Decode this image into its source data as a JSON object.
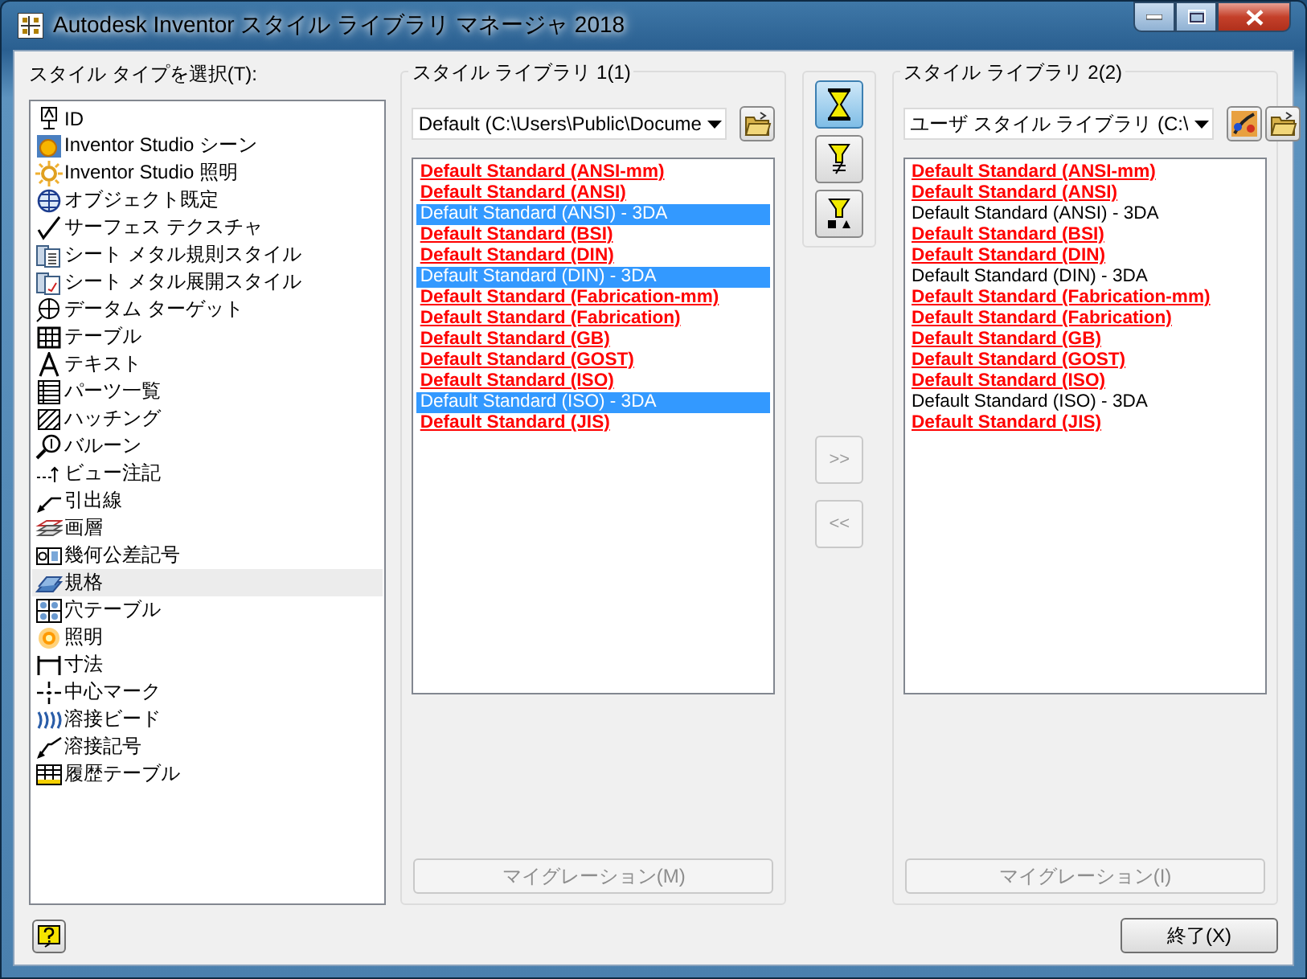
{
  "window": {
    "title": "Autodesk Inventor スタイル ライブラリ マネージャ 2018"
  },
  "style_types": {
    "label": "スタイル タイプを選択(T):",
    "items": [
      {
        "label": "ID",
        "selected": false
      },
      {
        "label": "Inventor Studio シーン",
        "selected": false
      },
      {
        "label": "Inventor Studio 照明",
        "selected": false
      },
      {
        "label": "オブジェクト既定",
        "selected": false
      },
      {
        "label": "サーフェス テクスチャ",
        "selected": false
      },
      {
        "label": "シート メタル規則スタイル",
        "selected": false
      },
      {
        "label": "シート メタル展開スタイル",
        "selected": false
      },
      {
        "label": "データム ターゲット",
        "selected": false
      },
      {
        "label": "テーブル",
        "selected": false
      },
      {
        "label": "テキスト",
        "selected": false
      },
      {
        "label": "パーツ一覧",
        "selected": false
      },
      {
        "label": "ハッチング",
        "selected": false
      },
      {
        "label": "バルーン",
        "selected": false
      },
      {
        "label": "ビュー注記",
        "selected": false
      },
      {
        "label": "引出線",
        "selected": false
      },
      {
        "label": "画層",
        "selected": false
      },
      {
        "label": "幾何公差記号",
        "selected": false
      },
      {
        "label": "規格",
        "selected": true
      },
      {
        "label": "穴テーブル",
        "selected": false
      },
      {
        "label": "照明",
        "selected": false
      },
      {
        "label": "寸法",
        "selected": false
      },
      {
        "label": "中心マーク",
        "selected": false
      },
      {
        "label": "溶接ビード",
        "selected": false
      },
      {
        "label": "溶接記号",
        "selected": false
      },
      {
        "label": "履歴テーブル",
        "selected": false
      }
    ]
  },
  "library_1": {
    "title": "スタイル ライブラリ 1(1)",
    "source": "Default (C:\\Users\\Public\\Docume",
    "migrate_button": "マイグレーション(M)",
    "migrate_disabled": true,
    "styles": [
      {
        "name": "Default Standard (ANSI-mm)",
        "kind": "differs",
        "selected": false
      },
      {
        "name": "Default Standard (ANSI)",
        "kind": "differs",
        "selected": false
      },
      {
        "name": "Default Standard (ANSI) - 3DA",
        "kind": "same",
        "selected": true
      },
      {
        "name": "Default Standard (BSI)",
        "kind": "differs",
        "selected": false
      },
      {
        "name": "Default Standard (DIN)",
        "kind": "differs",
        "selected": false
      },
      {
        "name": "Default Standard (DIN) - 3DA",
        "kind": "same",
        "selected": true
      },
      {
        "name": "Default Standard (Fabrication-mm)",
        "kind": "differs",
        "selected": false
      },
      {
        "name": "Default Standard (Fabrication)",
        "kind": "differs",
        "selected": false
      },
      {
        "name": "Default Standard (GB)",
        "kind": "differs",
        "selected": false
      },
      {
        "name": "Default Standard (GOST)",
        "kind": "differs",
        "selected": false
      },
      {
        "name": "Default Standard (ISO)",
        "kind": "differs",
        "selected": false
      },
      {
        "name": "Default Standard (ISO) - 3DA",
        "kind": "same",
        "selected": true
      },
      {
        "name": "Default Standard (JIS)",
        "kind": "differs",
        "selected": false
      }
    ]
  },
  "filters": [
    {
      "selected": true
    },
    {
      "selected": false
    },
    {
      "selected": false
    }
  ],
  "transfer_buttons": [
    {
      "label": ">>",
      "disabled": true
    },
    {
      "label": "<<",
      "disabled": true
    }
  ],
  "library_2": {
    "title": "スタイル ライブラリ 2(2)",
    "source": "ユーザ スタイル ライブラリ (C:\\",
    "migrate_button": "マイグレーション(I)",
    "migrate_disabled": true,
    "styles": [
      {
        "name": "Default Standard (ANSI-mm)",
        "kind": "differs",
        "selected": false
      },
      {
        "name": "Default Standard (ANSI)",
        "kind": "differs",
        "selected": false
      },
      {
        "name": "Default Standard (ANSI) - 3DA",
        "kind": "same",
        "selected": false
      },
      {
        "name": "Default Standard (BSI)",
        "kind": "differs",
        "selected": false
      },
      {
        "name": "Default Standard (DIN)",
        "kind": "differs",
        "selected": false
      },
      {
        "name": "Default Standard (DIN) - 3DA",
        "kind": "same",
        "selected": false
      },
      {
        "name": "Default Standard (Fabrication-mm)",
        "kind": "differs",
        "selected": false
      },
      {
        "name": "Default Standard (Fabrication)",
        "kind": "differs",
        "selected": false
      },
      {
        "name": "Default Standard (GB)",
        "kind": "differs",
        "selected": false
      },
      {
        "name": "Default Standard (GOST)",
        "kind": "differs",
        "selected": false
      },
      {
        "name": "Default Standard (ISO)",
        "kind": "differs",
        "selected": false
      },
      {
        "name": "Default Standard (ISO) - 3DA",
        "kind": "same",
        "selected": false
      },
      {
        "name": "Default Standard (JIS)",
        "kind": "differs",
        "selected": false
      }
    ]
  },
  "close_button": "終了(X)"
}
